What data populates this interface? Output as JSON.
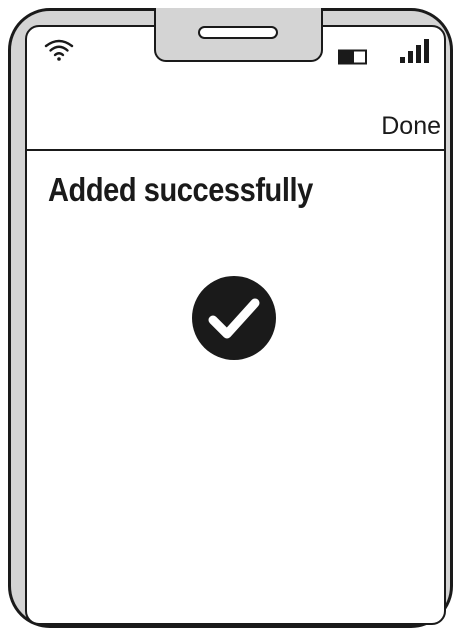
{
  "status_bar": {
    "wifi_icon": "wifi-icon",
    "battery_icon": "battery-icon",
    "signal_icon": "signal-bars-icon"
  },
  "header": {
    "done_label": "Done"
  },
  "main": {
    "title": "Added successfully",
    "success_icon": "check-circle-icon"
  },
  "colors": {
    "ink": "#1a1a1a",
    "frame_fill": "#d4d4d4",
    "screen": "#ffffff"
  }
}
